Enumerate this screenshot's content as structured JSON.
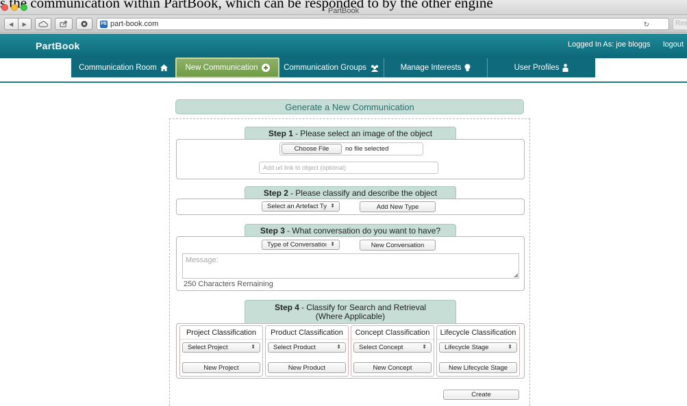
{
  "overlay_text": "s the communication within PartBook, which can be responded to by the other engine",
  "browser": {
    "title": "PartBook",
    "url": "part-book.com",
    "favicon_text": "PB",
    "reader_label": "Reader"
  },
  "header": {
    "brand": "PartBook",
    "logged_in": "Logged In As: joe bloggs",
    "logout": "logout"
  },
  "nav": {
    "items": [
      {
        "label": "Communication Room",
        "icon": "home-icon"
      },
      {
        "label": "New Communication",
        "icon": "plus-circle-icon"
      },
      {
        "label": "Communication Groups",
        "icon": "group-icon"
      },
      {
        "label": "Manage Interests",
        "icon": "lightbulb-icon"
      },
      {
        "label": "User Profiles",
        "icon": "user-icon"
      }
    ]
  },
  "page": {
    "title": "Generate a New Communication"
  },
  "step1": {
    "step": "Step 1",
    "text": "- Please select an image of the object",
    "choose_file": "Choose File",
    "file_status": "no file selected",
    "url_placeholder": "Add url link to object (optional)"
  },
  "step2": {
    "step": "Step 2",
    "text": "- Please classify and describe the object",
    "artefact_select": "Select an Artefact Ty",
    "add_new_type": "Add New Type"
  },
  "step3": {
    "step": "Step 3",
    "text": "- What conversation do you want to have?",
    "conversation_select": "Type of Conversatioı",
    "new_conversation": "New Conversation",
    "message_placeholder": "Message:",
    "chars_remaining": "250 Characters Remaining"
  },
  "step4": {
    "step": "Step 4",
    "text_line1": "- Classify for Search and Retrieval",
    "text_line2": "(Where Applicable)",
    "columns": [
      {
        "header": "Project Classification",
        "select": "Select Project",
        "button": "New Project"
      },
      {
        "header": "Product Classification",
        "select": "Select Product",
        "button": "New Product"
      },
      {
        "header": "Concept Classification",
        "select": "Select Concept",
        "button": "New Concept"
      },
      {
        "header": "Lifecycle Classification",
        "select": "Lifecycle Stage",
        "button": "New Lifecycle Stage"
      }
    ]
  },
  "actions": {
    "create": "Create"
  },
  "colors": {
    "header_teal": "#1f8a98",
    "nav_teal": "#0f6b7b",
    "active_green": "#7ea654",
    "panel_label": "#c7ded7"
  }
}
